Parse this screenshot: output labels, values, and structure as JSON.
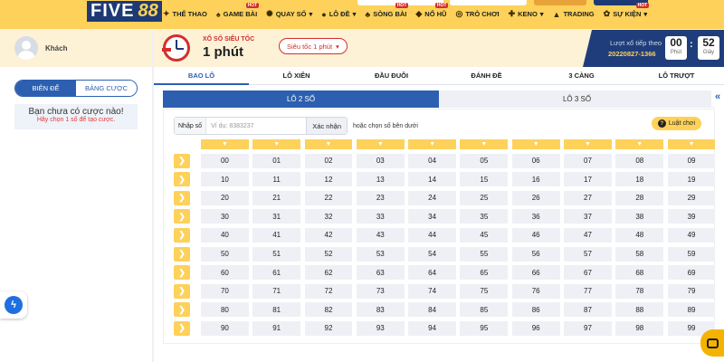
{
  "brand": {
    "name_a": "FIVE",
    "name_b": "88"
  },
  "nav": [
    {
      "label": "THỂ THAO",
      "icon": "trophy-icon",
      "glyph": "✦",
      "hot": false
    },
    {
      "label": "GAME BÀI",
      "icon": "cards-icon",
      "glyph": "♠",
      "hot": true
    },
    {
      "label": "QUAY SỐ",
      "icon": "lottery-icon",
      "glyph": "✺",
      "hot": false,
      "dropdown": true
    },
    {
      "label": "LÔ ĐỀ",
      "icon": "ball-icon",
      "glyph": "●",
      "hot": false,
      "dropdown": true
    },
    {
      "label": "SÒNG BÀI",
      "icon": "casino-icon",
      "glyph": "♣",
      "hot": true
    },
    {
      "label": "NỔ HŨ",
      "icon": "slot-icon",
      "glyph": "◆",
      "hot": true
    },
    {
      "label": "TRÒ CHƠI",
      "icon": "gamepad-icon",
      "glyph": "◎",
      "hot": false
    },
    {
      "label": "KENO",
      "icon": "keno-icon",
      "glyph": "✚",
      "hot": false,
      "dropdown": true
    },
    {
      "label": "TRADING",
      "icon": "chart-icon",
      "glyph": "▲",
      "hot": false
    },
    {
      "label": "SỰ KIỆN",
      "icon": "gift-icon",
      "glyph": "✿",
      "hot": true,
      "dropdown": true
    }
  ],
  "sidebar": {
    "username": "Khách",
    "tabs": [
      {
        "label": "BIÊN ĐỂ",
        "active": true
      },
      {
        "label": "BẢNG CƯỢC",
        "active": false
      }
    ],
    "empty_title": "Bạn chưa có cược nào!",
    "empty_sub": "Hãy chọn 1 số để tạo cược."
  },
  "game": {
    "subtitle": "XỔ SỐ SIÊU TỐC",
    "title": "1 phút",
    "speed_select": "Siêu tốc 1 phút",
    "next_label": "Lượt xổ tiếp theo",
    "next_id": "20220827-1366",
    "minutes": "00",
    "minutes_unit": "Phút",
    "seconds": "52",
    "seconds_unit": "Giây"
  },
  "main_tabs": [
    {
      "label": "BAO LÔ",
      "active": true
    },
    {
      "label": "LÔ XIÊN",
      "active": false
    },
    {
      "label": "ĐẦU ĐUÔI",
      "active": false
    },
    {
      "label": "ĐÁNH ĐỀ",
      "active": false
    },
    {
      "label": "3 CÀNG",
      "active": false
    },
    {
      "label": "LÔ TRƯỢT",
      "active": false
    }
  ],
  "sub_tabs": [
    {
      "label": "LÔ 2 SỐ",
      "active": true
    },
    {
      "label": "LÔ 3 SỐ",
      "active": false
    }
  ],
  "input": {
    "label": "Nhập số",
    "placeholder": "Ví dụ: 8383237",
    "confirm": "Xác nhận",
    "or_text": "hoặc",
    "or_emph": "chọn số bên dưới"
  },
  "rule_button": "Luật chơi",
  "number_rows": [
    [
      "00",
      "01",
      "02",
      "03",
      "04",
      "05",
      "06",
      "07",
      "08",
      "09"
    ],
    [
      "10",
      "11",
      "12",
      "13",
      "14",
      "15",
      "16",
      "17",
      "18",
      "19"
    ],
    [
      "20",
      "21",
      "22",
      "23",
      "24",
      "25",
      "26",
      "27",
      "28",
      "29"
    ],
    [
      "30",
      "31",
      "32",
      "33",
      "34",
      "35",
      "36",
      "37",
      "38",
      "39"
    ],
    [
      "40",
      "41",
      "42",
      "43",
      "44",
      "45",
      "46",
      "47",
      "48",
      "49"
    ],
    [
      "50",
      "51",
      "52",
      "53",
      "54",
      "55",
      "56",
      "57",
      "58",
      "59"
    ],
    [
      "60",
      "61",
      "62",
      "63",
      "64",
      "65",
      "66",
      "67",
      "68",
      "69"
    ],
    [
      "70",
      "71",
      "72",
      "73",
      "74",
      "75",
      "76",
      "77",
      "78",
      "79"
    ],
    [
      "80",
      "81",
      "82",
      "83",
      "84",
      "85",
      "86",
      "87",
      "88",
      "89"
    ],
    [
      "90",
      "91",
      "92",
      "93",
      "94",
      "95",
      "96",
      "97",
      "98",
      "99"
    ]
  ],
  "colors": {
    "accent_blue": "#2d5fb1",
    "brand_yellow": "#fdd15a",
    "alert_red": "#d32f2f"
  }
}
